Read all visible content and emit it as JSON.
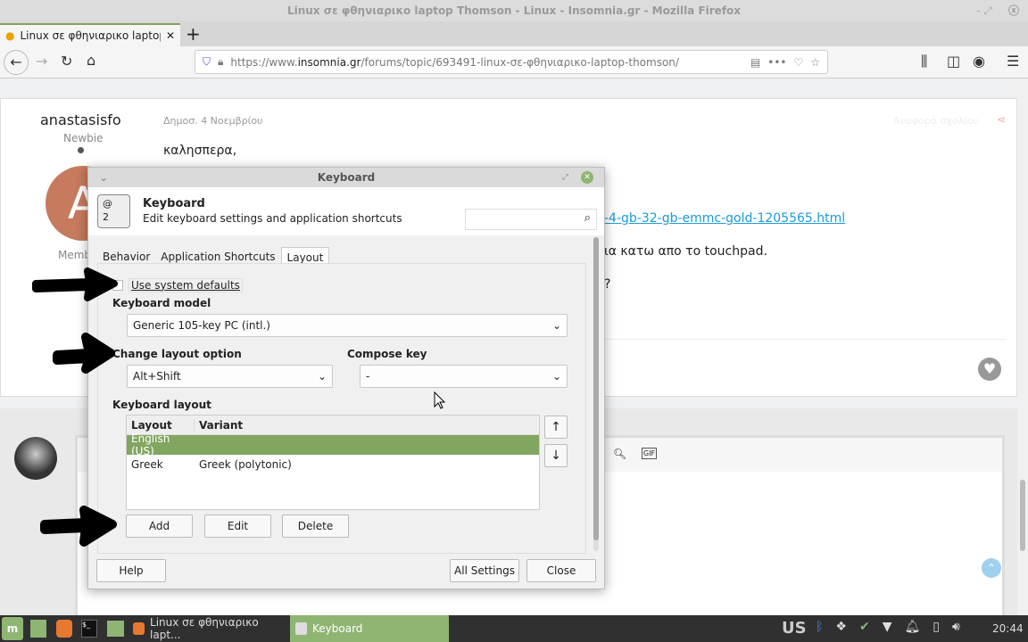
{
  "window": {
    "title": "Linux σε φθηνιαρικο laptop Thomson - Linux - Insomnia.gr - Mozilla Firefox"
  },
  "browser": {
    "tab_label": "Linux σε φθηνιαρικο laptop",
    "url_pre": "https://www.",
    "url_domain": "insomnia.gr",
    "url_post": "/forums/topic/693491-linux-σε-φθηνιαρικο-laptop-thomson/"
  },
  "post": {
    "author": "anastasisfo",
    "rank": "Newbie",
    "member_label": "Memb",
    "date": "Δημοσ. 4 Νοεμβρίου",
    "report": "Αναφορά σχολίου",
    "greeting": "καλησπερα,",
    "link": "-4-gb-32-gb-emmc-gold-1205565.html",
    "line2": "ια κατω απο το touchpad.",
    "line3": "?",
    "avatar_letter": "A"
  },
  "dialog": {
    "title": "Keyboard",
    "app_name": "Keyboard",
    "app_desc": "Edit keyboard settings and application shortcuts",
    "search_placeholder": "",
    "tabs": [
      "Behavior",
      "Application Shortcuts",
      "Layout"
    ],
    "use_defaults": "Use system defaults",
    "model_label": "Keyboard model",
    "model_value": "Generic 105-key PC (intl.)",
    "change_label": "Change layout option",
    "change_value": "Alt+Shift",
    "compose_label": "Compose key",
    "compose_value": "-",
    "layout_label": "Keyboard layout",
    "columns": [
      "Layout",
      "Variant"
    ],
    "rows": [
      {
        "layout": "English (US)",
        "variant": ""
      },
      {
        "layout": "Greek",
        "variant": "Greek (polytonic)"
      }
    ],
    "add": "Add",
    "edit": "Edit",
    "delete": "Delete",
    "help": "Help",
    "all_settings": "All Settings",
    "close": "Close"
  },
  "taskbar": {
    "firefox_item": "Linux σε φθηνιαρικο lapt...",
    "keyboard_item": "Keyboard",
    "lang": "US",
    "clock": "20:44"
  },
  "colors": {
    "accent": "#8fb573",
    "selected_row": "#82a660",
    "link": "#1a9bd7"
  }
}
